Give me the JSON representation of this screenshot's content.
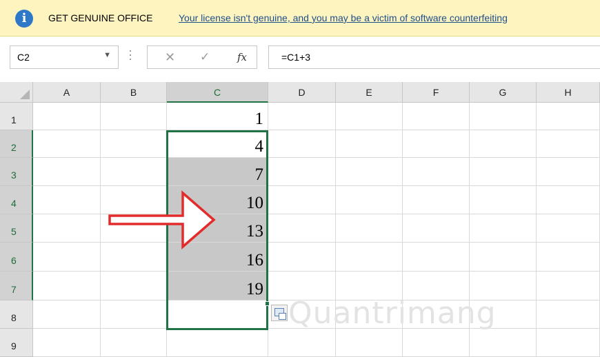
{
  "info_bar": {
    "title": "GET GENUINE OFFICE",
    "message": "Your license isn't genuine, and you may be a victim of software counterfeiting"
  },
  "formula_bar": {
    "name_box": "C2",
    "formula": "=C1+3",
    "fx_label": "fx"
  },
  "columns": [
    "A",
    "B",
    "C",
    "D",
    "E",
    "F",
    "G",
    "H"
  ],
  "selected_column": "C",
  "rows": [
    "1",
    "2",
    "3",
    "4",
    "5",
    "6",
    "7",
    "8",
    "9"
  ],
  "selected_rows": [
    "2",
    "3",
    "4",
    "5",
    "6",
    "7"
  ],
  "column_c_values": [
    "1",
    "4",
    "7",
    "10",
    "13",
    "16",
    "19",
    ""
  ],
  "watermark": "Quantrimang",
  "colors": {
    "selection_green": "#217346",
    "arrow_red": "#e32b2b",
    "info_blue": "#2f77c7",
    "info_bar_bg": "#fdf4bf",
    "highlight_gray": "#c8c8c8"
  }
}
